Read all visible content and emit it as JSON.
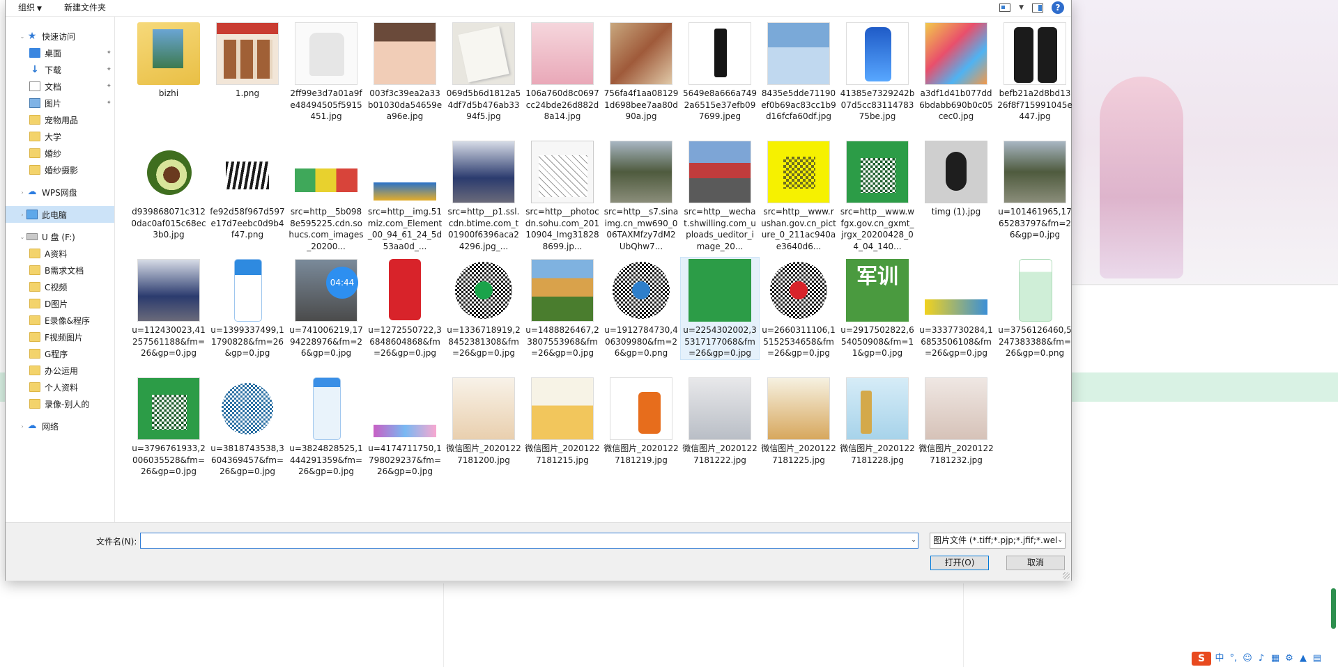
{
  "toolbar": {
    "organize": "组织",
    "new_folder": "新建文件夹"
  },
  "nav": {
    "quick_access": "快速访问",
    "desktop": "桌面",
    "downloads": "下载",
    "documents": "文档",
    "pictures": "图片",
    "pets": "宠物用品",
    "university": "大学",
    "wedding_dress": "婚纱",
    "wedding_photo": "婚纱摄影",
    "wps": "WPS网盘",
    "this_pc": "此电脑",
    "drive": "U 盘 (F:)",
    "f_items": [
      "A资料",
      "B需求文档",
      "C视频",
      "D图片",
      "E录像&程序",
      "F视频图片",
      "G程序",
      "办公运用",
      "个人资料",
      "录像-别人的"
    ],
    "network": "网络"
  },
  "files": [
    "bizhi",
    "1.png",
    "2ff99e3d7a01a9fe48494505f5915451.jpg",
    "003f3c39ea2a33b01030da54659ea96e.jpg",
    "069d5b6d1812a54df7d5b476ab3394f5.jpg",
    "106a760d8c0697cc24bde26d882d8a14.jpg",
    "756fa4f1aa081291d698bee7aa80d90a.jpg",
    "5649e8a666a7492a6515e37efb097699.jpeg",
    "8435e5dde71190ef0b69ac83cc1b9d16fcfa60df.jpg",
    "41385e7329242b07d5cc8311478375be.jpg",
    "a3df1d41b077dd6bdabb690b0c05cec0.jpg",
    "befb21a2d8bd1326f8f715991045e447.jpg",
    "d939868071c3120dac0af015c68ec3b0.jpg",
    "fe92d58f967d597e17d7eebc0d9b4f47.png",
    "src=http__5b0988e595225.cdn.sohucs.com_images_20200...",
    "src=http__img.51miz.com_Element_00_94_61_24_5d53aa0d_...",
    "src=http__p1.ssl.cdn.btime.com_t01900f6396aca24296.jpg_...",
    "src=http__photocdn.sohu.com_20110904_Img318288699.jp...",
    "src=http__s7.sinaimg.cn_mw690_006TAXMfzy7dM2UbQhw7...",
    "src=http__wechat.shwilling.com_uploads_ueditor_image_20...",
    "src=http__www.rushan.gov.cn_picture_0_211ac940ae3640d6...",
    "src=http__www.wfgx.gov.cn_gxmt_jrgx_20200428_04_04_140...",
    "timg (1).jpg",
    "u=101461965,1765283797&fm=26&gp=0.jpg",
    "u=112430023,41257561188&fm=26&gp=0.jpg",
    "u=1399337499,11790828&fm=26&gp=0.jpg",
    "u=741006219,1794228976&fm=26&gp=0.jpg",
    "u=1272550722,36848604868&fm=26&gp=0.jpg",
    "u=1336718919,28452381308&fm=26&gp=0.jpg",
    "u=1488826467,23807553968&fm=26&gp=0.jpg",
    "u=1912784730,406309980&fm=26&gp=0.png",
    "u=2254302002,35317177068&fm=26&gp=0.jpg",
    "u=2660311106,15152534658&fm=26&gp=0.jpg",
    "u=2917502822,654050908&fm=11&gp=0.jpg",
    "u=3337730284,16853506108&fm=26&gp=0.jpg",
    "u=3756126460,5247383388&fm=26&gp=0.png",
    "u=3796761933,2006035528&fm=26&gp=0.jpg",
    "u=3818743538,3604369457&fm=26&gp=0.jpg",
    "u=3824828525,1444291359&fm=26&gp=0.jpg",
    "u=4174711750,1798029237&fm=26&gp=0.jpg",
    "微信图片_20201227181200.jpg",
    "微信图片_20201227181215.jpg",
    "微信图片_20201227181219.jpg",
    "微信图片_20201227181222.jpg",
    "微信图片_20201227181225.jpg",
    "微信图片_20201227181228.jpg",
    "微信图片_20201227181232.jpg"
  ],
  "thumb_badge": "04:44",
  "thumb_text_junxun": "军训",
  "form": {
    "filename_label": "文件名(N):",
    "filename_value": "",
    "filetype": "图片文件 (*.tiff;*.pjp;*.jfif;*.wel",
    "open": "打开(O)",
    "cancel": "取消"
  },
  "ime": {
    "logo": "S",
    "lang": "中"
  }
}
